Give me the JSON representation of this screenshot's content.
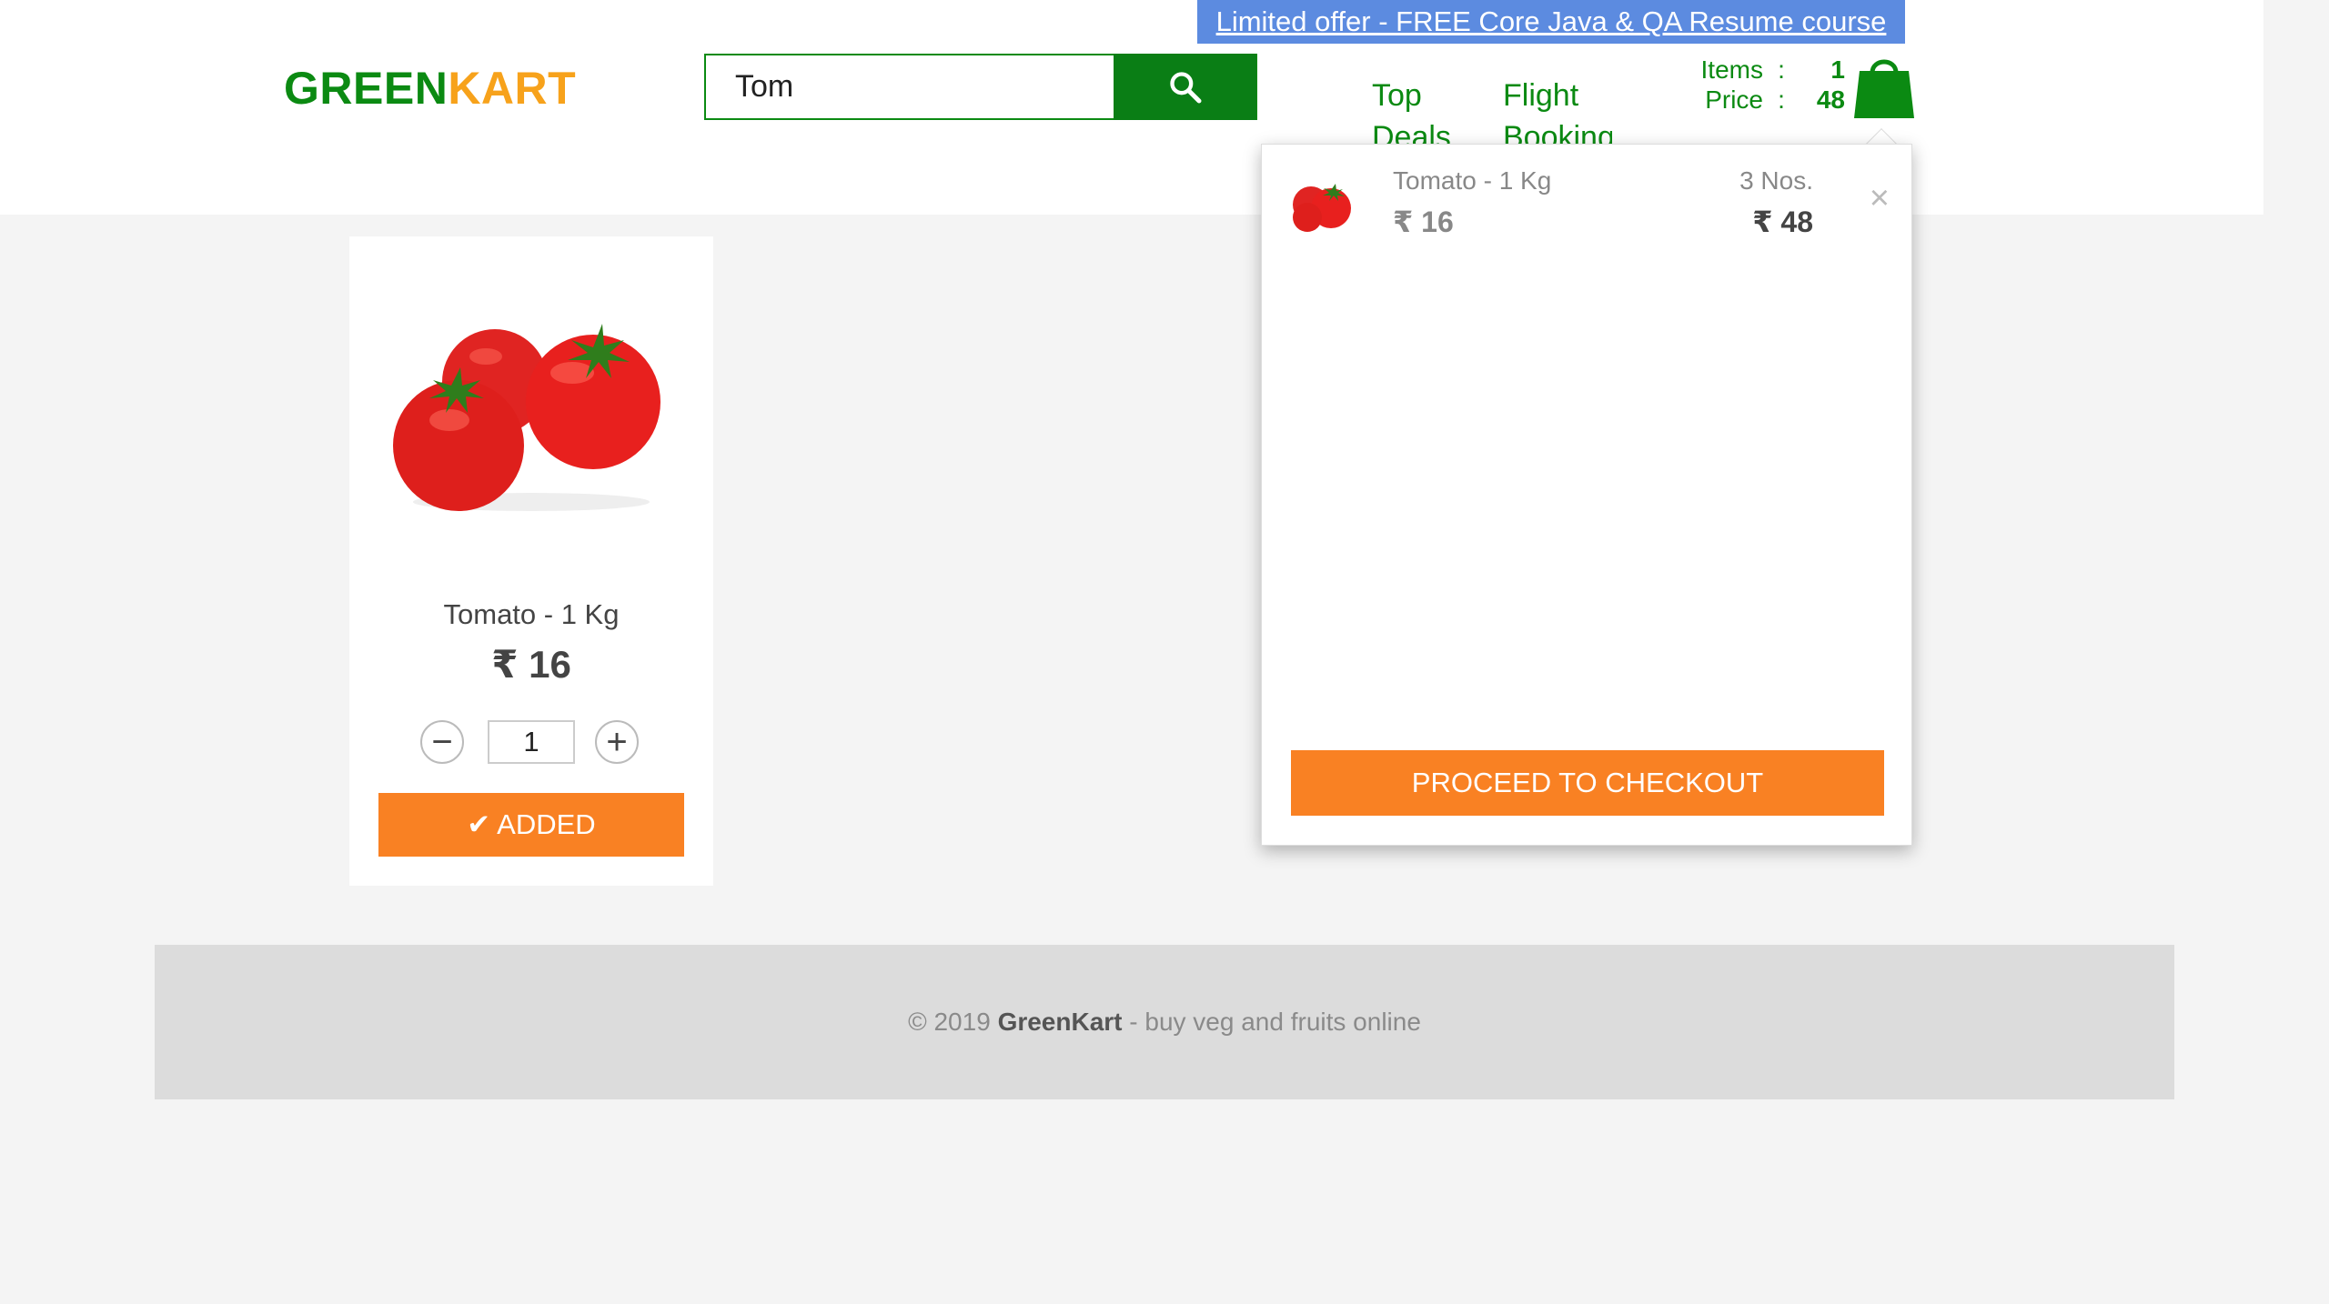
{
  "promo": {
    "text": "Limited offer - FREE Core Java & QA Resume course"
  },
  "brand": {
    "green": "GREEN",
    "kart": "KART"
  },
  "search": {
    "value": "Tom",
    "button_icon": "search-icon"
  },
  "nav": {
    "top_deals": "Top Deals",
    "flight_booking": "Flight Booking"
  },
  "summary": {
    "items_label": "Items",
    "items_value": "1",
    "price_label": "Price",
    "price_value": "48",
    "separator": ":"
  },
  "product": {
    "name": "Tomato - 1 Kg",
    "price": "₹ 16",
    "quantity": "1",
    "decrement": "−",
    "increment": "+",
    "button_label": "✔ ADDED"
  },
  "cart_preview": {
    "items": [
      {
        "name": "Tomato - 1 Kg",
        "price": "₹ 16",
        "quantity": "3 Nos.",
        "amount": "₹ 48",
        "remove": "×"
      }
    ],
    "checkout_label": "PROCEED TO CHECKOUT"
  },
  "footer": {
    "copyright": "© 2019",
    "brand": "GreenKart",
    "tagline": "- buy veg and fruits online"
  },
  "colors": {
    "brand_green": "#0b8a12",
    "brand_orange": "#f7a21b",
    "button_orange": "#f98123",
    "promo_blue": "#5c8be0"
  }
}
